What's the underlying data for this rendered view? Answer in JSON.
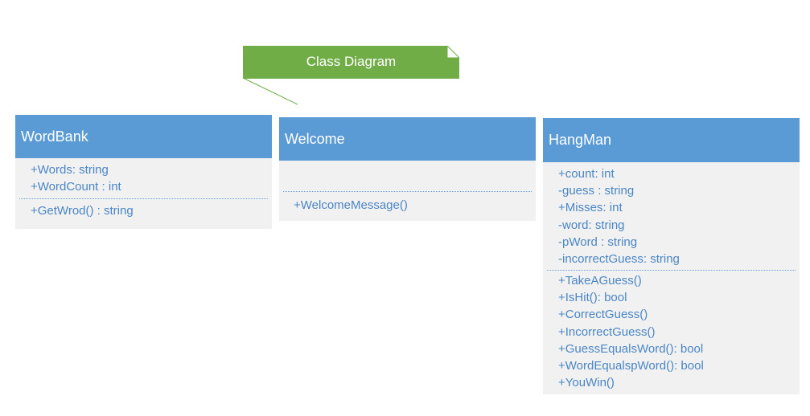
{
  "note": {
    "title": "Class Diagram",
    "fill_color": "#70ad47"
  },
  "colors": {
    "header": "#5b9bd5",
    "body": "#f1f1f1",
    "member_text": "#4a86c5"
  },
  "classes": {
    "wordbank": {
      "name": "WordBank",
      "attributes": [
        "+Words: string",
        "+WordCount : int"
      ],
      "operations": [
        "+GetWrod() : string"
      ]
    },
    "welcome": {
      "name": "Welcome",
      "attributes": [],
      "operations": [
        "+WelcomeMessage()"
      ]
    },
    "hangman": {
      "name": "HangMan",
      "attributes": [
        "+count: int",
        "-guess : string",
        "+Misses: int",
        "-word: string",
        "-pWord : string",
        "-incorrectGuess: string"
      ],
      "operations": [
        "+TakeAGuess()",
        "+IsHit(): bool",
        "+CorrectGuess()",
        "+IncorrectGuess()",
        "+GuessEqualsWord(): bool",
        "+WordEqualspWord(): bool",
        "+YouWin()"
      ]
    }
  }
}
